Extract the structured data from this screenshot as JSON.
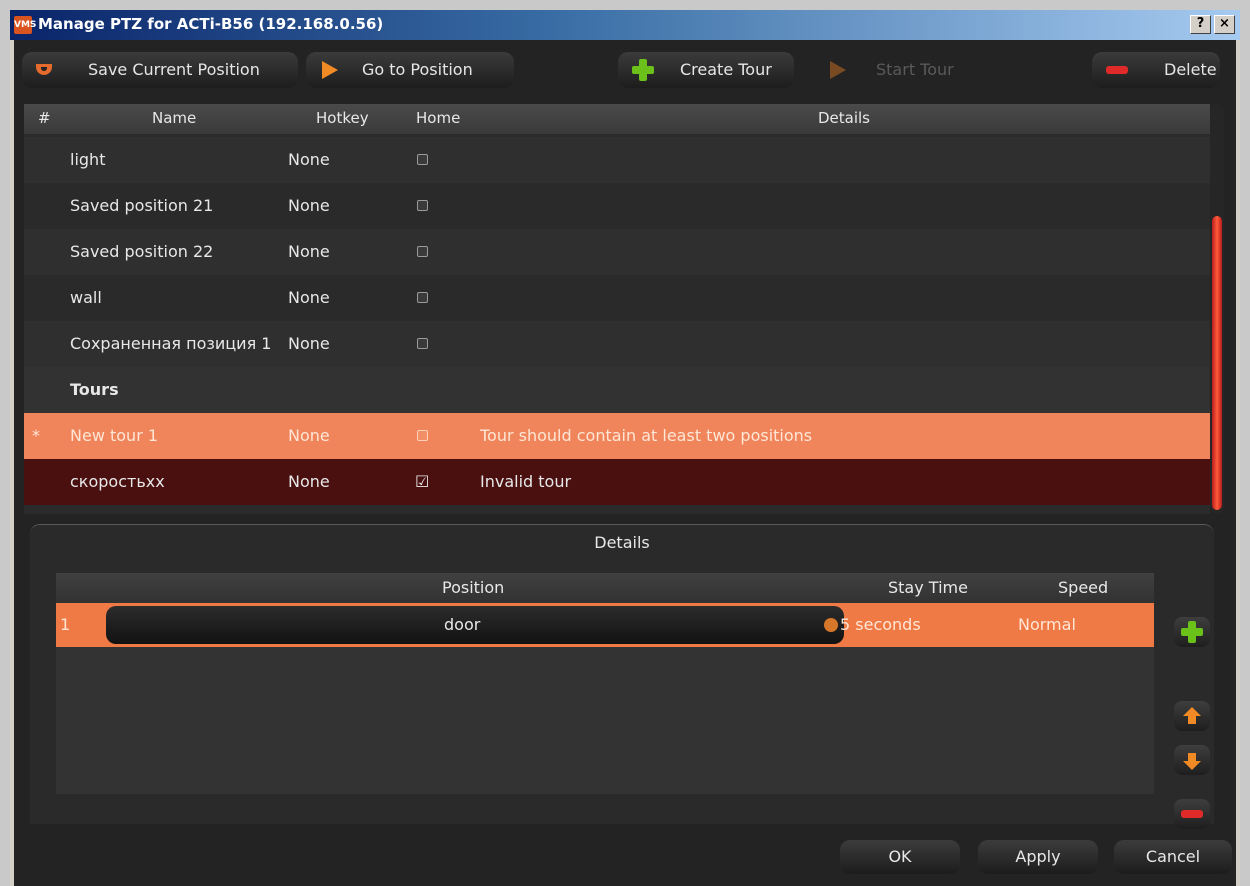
{
  "window": {
    "icon_text": "VMS",
    "title": "Manage PTZ for ACTi-B56 (192.168.0.56)",
    "help_label": "?",
    "close_label": "×"
  },
  "toolbar": {
    "save_position": "Save Current Position",
    "go_to_position": "Go to Position",
    "create_tour": "Create Tour",
    "start_tour": "Start Tour",
    "delete": "Delete"
  },
  "table": {
    "headers": {
      "num": "#",
      "name": "Name",
      "hotkey": "Hotkey",
      "home": "Home",
      "details": "Details"
    },
    "rows": [
      {
        "name": "light",
        "hotkey": "None",
        "home": false,
        "details": ""
      },
      {
        "name": "Saved position 21",
        "hotkey": "None",
        "home": false,
        "details": ""
      },
      {
        "name": "Saved position 22",
        "hotkey": "None",
        "home": false,
        "details": ""
      },
      {
        "name": "wall",
        "hotkey": "None",
        "home": false,
        "details": ""
      },
      {
        "name": "Сохраненная позиция 1",
        "hotkey": "None",
        "home": false,
        "details": ""
      }
    ],
    "group_label": "Tours",
    "tours": [
      {
        "marker": "*",
        "name": "New tour 1",
        "hotkey": "None",
        "home": false,
        "details": "Tour should contain at least two positions"
      },
      {
        "marker": "",
        "name": "скоростьхх",
        "hotkey": "None",
        "home": true,
        "details": "Invalid tour"
      }
    ]
  },
  "details": {
    "title": "Details",
    "headers": {
      "position": "Position",
      "stay_time": "Stay Time",
      "speed": "Speed"
    },
    "rows": [
      {
        "index": "1",
        "position": "door",
        "stay_time": "5 seconds",
        "speed": "Normal"
      }
    ]
  },
  "footer": {
    "ok": "OK",
    "apply": "Apply",
    "cancel": "Cancel"
  },
  "colors": {
    "accent_orange": "#f0845a",
    "error_row": "#4a0f0f",
    "add_green": "#6cc01a",
    "delete_red": "#e02a2a",
    "scrollbar_red": "#ff5a3a"
  }
}
